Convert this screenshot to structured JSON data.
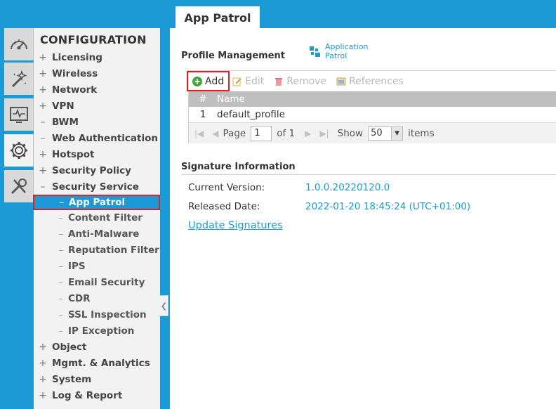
{
  "page_tab": "App Patrol",
  "nav": {
    "title": "CONFIGURATION",
    "items_top": [
      {
        "sign": "+",
        "label": "Licensing"
      },
      {
        "sign": "+",
        "label": "Wireless"
      },
      {
        "sign": "+",
        "label": "Network"
      },
      {
        "sign": "+",
        "label": "VPN"
      },
      {
        "sign": "–",
        "label": "BWM"
      },
      {
        "sign": "–",
        "label": "Web Authentication"
      },
      {
        "sign": "+",
        "label": "Hotspot"
      },
      {
        "sign": "+",
        "label": "Security Policy"
      },
      {
        "sign": "–",
        "label": "Security Service"
      }
    ],
    "sub_items": [
      {
        "label": "App Patrol",
        "selected": true
      },
      {
        "label": "Content Filter"
      },
      {
        "label": "Anti-Malware"
      },
      {
        "label": "Reputation Filter"
      },
      {
        "label": "IPS"
      },
      {
        "label": "Email Security"
      },
      {
        "label": "CDR"
      },
      {
        "label": "SSL Inspection"
      },
      {
        "label": "IP Exception"
      }
    ],
    "items_bottom": [
      {
        "sign": "+",
        "label": "Object"
      },
      {
        "sign": "+",
        "label": "Mgmt. & Analytics"
      },
      {
        "sign": "+",
        "label": "System"
      },
      {
        "sign": "+",
        "label": "Log & Report"
      }
    ],
    "sub_dash": "–"
  },
  "rail": [
    "dashboard-icon",
    "wizard-icon",
    "monitor-icon",
    "gear-icon",
    "tools-icon"
  ],
  "profile": {
    "title": "Profile Management",
    "app_link_line1": "Application",
    "app_link_line2": "Patrol",
    "toolbar": {
      "add": "Add",
      "edit": "Edit",
      "remove": "Remove",
      "references": "References"
    },
    "table": {
      "headers": [
        "#",
        "Name"
      ],
      "rows": [
        {
          "num": "1",
          "name": "default_profile"
        }
      ]
    },
    "pager": {
      "page_label": "Page",
      "page_value": "1",
      "of_label": "of 1",
      "show_label": "Show",
      "show_value": "50",
      "items_label": "items"
    }
  },
  "signature": {
    "title": "Signature Information",
    "current_version_label": "Current Version:",
    "current_version_value": "1.0.0.20220120.0",
    "released_date_label": "Released Date:",
    "released_date_value": "2022-01-20 18:45:24 (UTC+01:00)",
    "update_link": "Update Signatures"
  },
  "colors": {
    "accent": "#1b9ad6",
    "highlight_border": "#d8232a",
    "add_icon": "#3aa935",
    "remove_icon": "#e05a5a"
  }
}
